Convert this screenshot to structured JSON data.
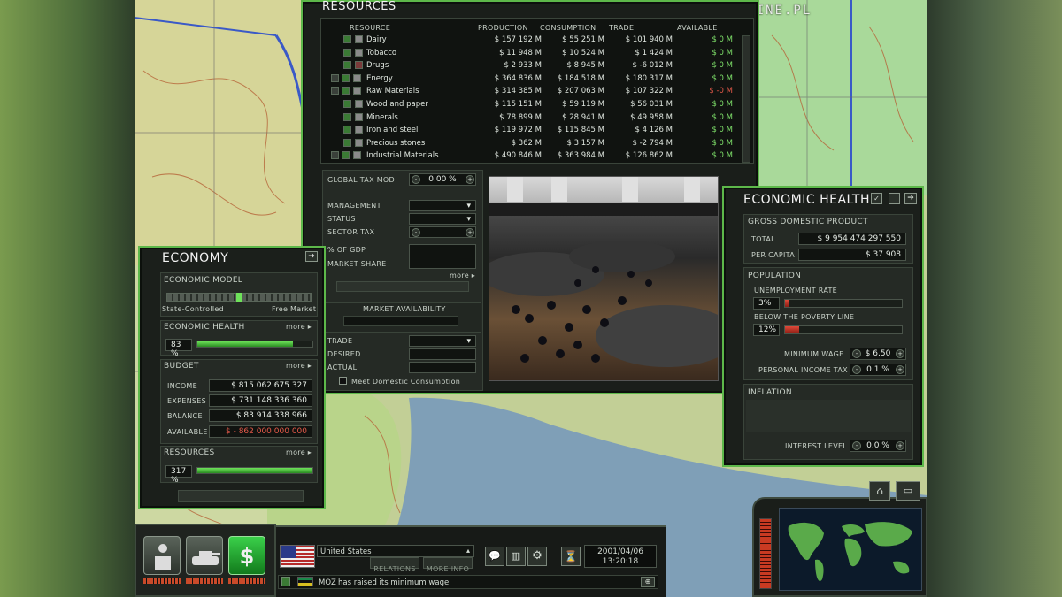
{
  "watermark": "WWW.GRY-ONLINE.PL",
  "resources": {
    "title": "RESOURCES",
    "columns": [
      "RESOURCE",
      "PRODUCTION",
      "CONSUMPTION",
      "TRADE",
      "AVAILABLE"
    ],
    "rows": [
      {
        "name": "Dairy",
        "production": "$ 157 192 M",
        "consumption": "$ 55 251 M",
        "trade": "$ 101 940 M",
        "available": "$ 0 M"
      },
      {
        "name": "Tobacco",
        "production": "$ 11 948 M",
        "consumption": "$ 10 524 M",
        "trade": "$ 1 424 M",
        "available": "$ 0 M"
      },
      {
        "name": "Drugs",
        "production": "$ 2 933 M",
        "consumption": "$ 8 945 M",
        "trade": "$ -6 012 M",
        "available": "$ 0 M"
      },
      {
        "name": "Energy",
        "production": "$ 364 836 M",
        "consumption": "$ 184 518 M",
        "trade": "$ 180 317 M",
        "available": "$ 0 M"
      },
      {
        "name": "Raw Materials",
        "production": "$ 314 385 M",
        "consumption": "$ 207 063 M",
        "trade": "$ 107 322 M",
        "available": "$ -0 M"
      },
      {
        "name": "Wood and paper",
        "production": "$ 115 151 M",
        "consumption": "$ 59 119 M",
        "trade": "$ 56 031 M",
        "available": "$ 0 M"
      },
      {
        "name": "Minerals",
        "production": "$ 78 899 M",
        "consumption": "$ 28 941 M",
        "trade": "$ 49 958 M",
        "available": "$ 0 M"
      },
      {
        "name": "Iron and steel",
        "production": "$ 119 972 M",
        "consumption": "$ 115 845 M",
        "trade": "$ 4 126 M",
        "available": "$ 0 M"
      },
      {
        "name": "Precious stones",
        "production": "$ 362 M",
        "consumption": "$ 3 157 M",
        "trade": "$ -2 794 M",
        "available": "$ 0 M"
      },
      {
        "name": "Industrial Materials",
        "production": "$ 490 846 M",
        "consumption": "$ 363 984 M",
        "trade": "$ 126 862 M",
        "available": "$ 0 M"
      }
    ],
    "global_tax_mod_label": "GLOBAL TAX MOD",
    "global_tax_mod_value": "0.00 %",
    "management_label": "MANAGEMENT",
    "status_label": "STATUS",
    "sector_tax_label": "SECTOR TAX",
    "pct_gdp_label": "% OF GDP",
    "market_share_label": "MARKET SHARE",
    "more": "more",
    "market_availability_label": "MARKET AVAILABILITY",
    "trade_label": "TRADE",
    "desired_label": "DESIRED",
    "actual_label": "ACTUAL",
    "meet_domestic": "Meet Domestic Consumption"
  },
  "economy": {
    "title": "ECONOMY",
    "model_label": "ECONOMIC MODEL",
    "model_left": "State-Controlled",
    "model_right": "Free Market",
    "model_position": 0.5,
    "health_label": "ECONOMIC HEALTH",
    "health_value": "83 %",
    "health_fraction": 0.83,
    "budget_label": "BUDGET",
    "income_label": "INCOME",
    "income_value": "$ 815 062 675 327",
    "expenses_label": "EXPENSES",
    "expenses_value": "$ 731 148 336 360",
    "balance_label": "BALANCE",
    "balance_value": "$ 83 914 338 966",
    "available_label": "AVAILABLE",
    "available_value": "$ - 862 000 000 000",
    "resources_label": "RESOURCES",
    "resources_value": "317 %",
    "resources_fraction": 1.0,
    "more": "more"
  },
  "health": {
    "title": "ECONOMIC HEALTH",
    "gdp_label": "GROSS DOMESTIC PRODUCT",
    "total_label": "TOTAL",
    "total_value": "$ 9 954 474 297 550",
    "per_capita_label": "PER CAPITA",
    "per_capita_value": "$ 37 908",
    "population_label": "POPULATION",
    "unemployment_label": "UNEMPLOYMENT RATE",
    "unemployment_value": "3%",
    "unemployment_fraction": 0.03,
    "poverty_label": "BELOW THE POVERTY LINE",
    "poverty_value": "12%",
    "poverty_fraction": 0.12,
    "min_wage_label": "MINIMUM WAGE",
    "min_wage_value": "$ 6.50",
    "income_tax_label": "PERSONAL INCOME TAX",
    "income_tax_value": "0.1 %",
    "inflation_label": "INFLATION",
    "interest_label": "INTEREST LEVEL",
    "interest_value": "0.0 %"
  },
  "bottom": {
    "country": "United States",
    "relations": "RELATIONS",
    "more_info": "MORE INFO",
    "date": "2001/04/06",
    "time": "13:20:18",
    "news_country": "MOZ",
    "news_text": "has raised its minimum wage",
    "money_symbol": "$"
  }
}
